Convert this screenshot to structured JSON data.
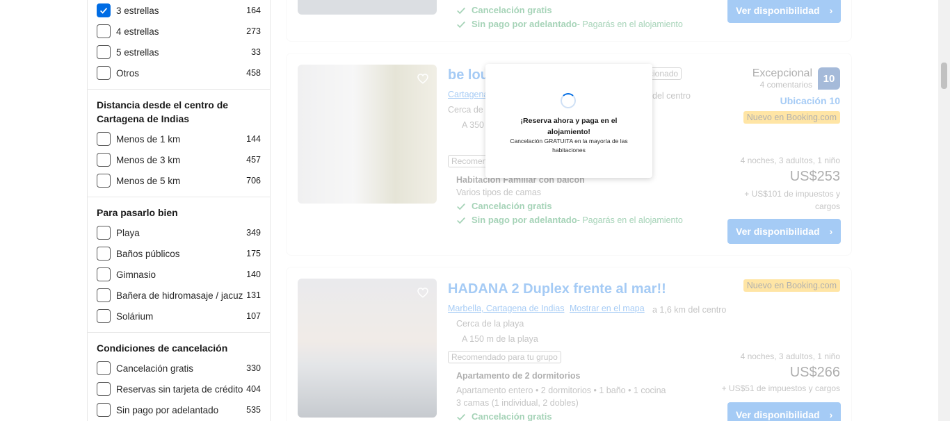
{
  "sidebar": {
    "stars": [
      {
        "label": "3 estrellas",
        "count": "164",
        "checked": true
      },
      {
        "label": "4 estrellas",
        "count": "273",
        "checked": false
      },
      {
        "label": "5 estrellas",
        "count": "33",
        "checked": false
      },
      {
        "label": "Otros",
        "count": "458",
        "checked": false
      }
    ],
    "distance": {
      "title": "Distancia desde el centro de Cartagena de Indias",
      "items": [
        {
          "label": "Menos de 1 km",
          "count": "144"
        },
        {
          "label": "Menos de 3 km",
          "count": "457"
        },
        {
          "label": "Menos de 5 km",
          "count": "706"
        }
      ]
    },
    "fun": {
      "title": "Para pasarlo bien",
      "items": [
        {
          "label": "Playa",
          "count": "349"
        },
        {
          "label": "Baños públicos",
          "count": "175"
        },
        {
          "label": "Gimnasio",
          "count": "140"
        },
        {
          "label": "Bañera de hidromasaje / jacuzzi",
          "count": "131"
        },
        {
          "label": "Solárium",
          "count": "107"
        }
      ]
    },
    "cancel": {
      "title": "Condiciones de cancelación",
      "items": [
        {
          "label": "Cancelación gratis",
          "count": "330"
        },
        {
          "label": "Reservas sin tarjeta de crédito",
          "count": "404"
        },
        {
          "label": "Sin pago por adelantado",
          "count": "535"
        }
      ]
    }
  },
  "card0": {
    "free_cancel": "Cancelación gratis",
    "no_prepay": "Sin pago por adelantado",
    "no_prepay_note": " - Pagarás en el alojamiento",
    "button": "Ver disponibilidad"
  },
  "card1": {
    "title": "be lou",
    "location": "Cartagena",
    "distance_tail": "del centro",
    "tag_partial": "cionado",
    "near": "Cerca de la",
    "beach": "A 350",
    "recommended": "Recomendado",
    "rating_word": "Excepcional",
    "reviews": "4 comentarios",
    "score": "10",
    "location_score": "Ubicación 10",
    "new_badge": "Nuevo en Booking.com",
    "room": "Habitación Familiar con balcón",
    "beds": "Varios tipos de camas",
    "free_cancel": "Cancelación gratis",
    "no_prepay": "Sin pago por adelantado",
    "no_prepay_note": " - Pagarás en el alojamiento",
    "stay": "4 noches, 3 adultos, 1 niño",
    "price": "US$253",
    "taxes": "+ US$101 de impuestos y cargos",
    "button": "Ver disponibilidad"
  },
  "card2": {
    "title": "HADANA 2 Duplex frente al mar!!",
    "location": "Marbella, Cartagena de Indias",
    "map_link": "Mostrar en el mapa",
    "distance": "a 1,6 km del centro",
    "near": "Cerca de la playa",
    "beach": "A 150 m de la playa",
    "recommended": "Recomendado para tu grupo",
    "new_badge": "Nuevo en Booking.com",
    "room": "Apartamento de 2 dormitorios",
    "room_detail": "Apartamento entero • 2 dormitorios • 1 baño • 1 cocina",
    "beds": "3 camas (1 individual, 2 dobles)",
    "free_cancel": "Cancelación gratis",
    "stay": "4 noches, 3 adultos, 1 niño",
    "price": "US$266",
    "taxes": "+ US$51 de impuestos y cargos",
    "button": "Ver disponibilidad"
  },
  "overlay": {
    "title": "¡Reserva ahora y paga en el alojamiento!",
    "subtitle": "Cancelación GRATUITA en la mayoría de las habitaciones"
  }
}
